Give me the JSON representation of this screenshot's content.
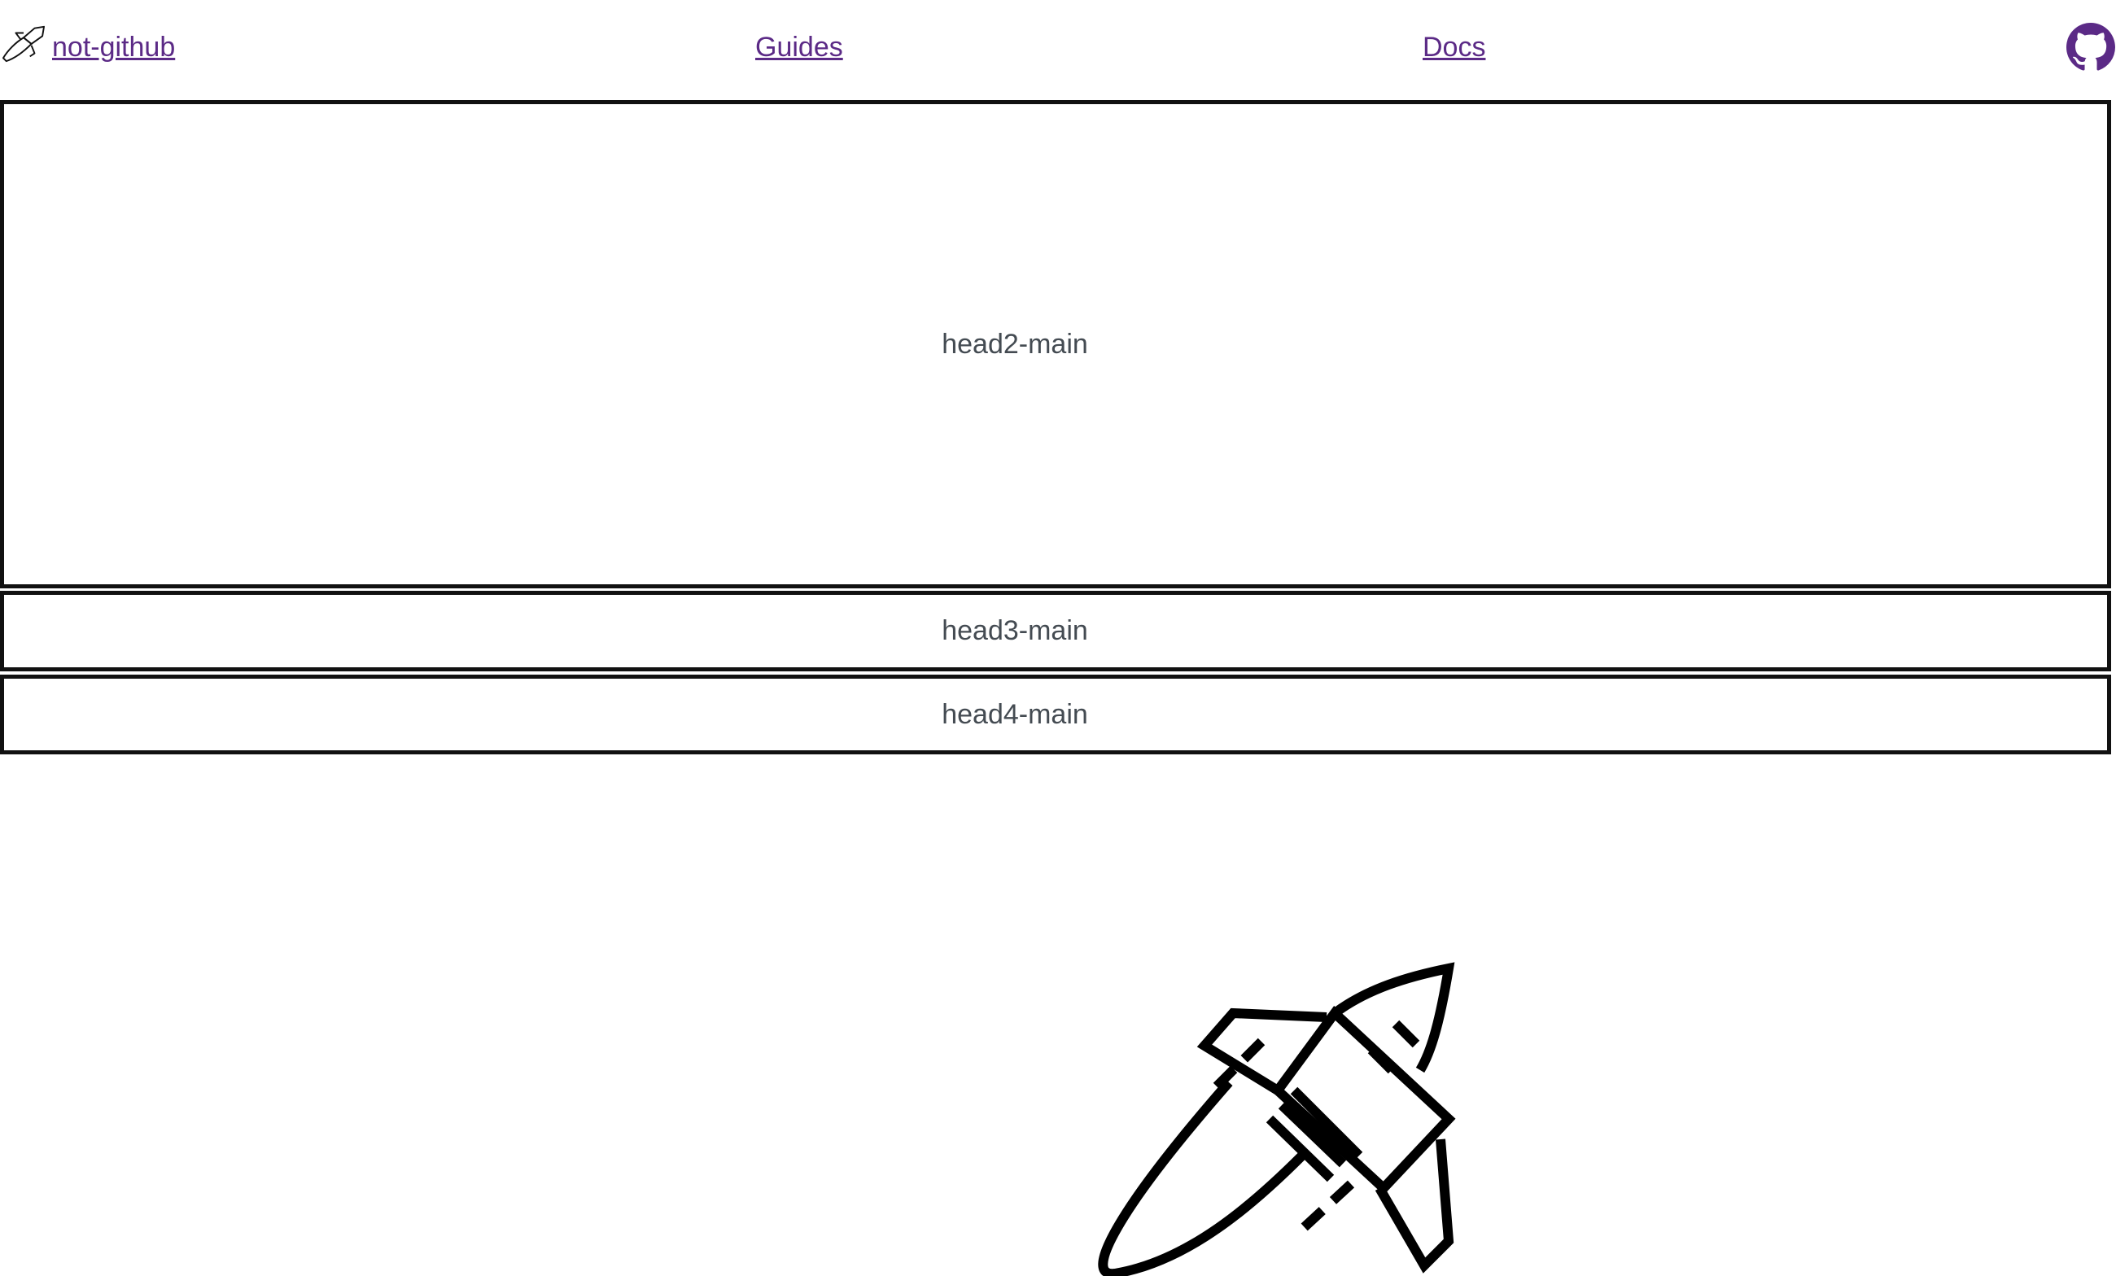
{
  "nav": {
    "brand_label": " not-github",
    "brand_icon": "rocket-icon",
    "links": [
      {
        "label": "Guides"
      },
      {
        "label": "Docs"
      }
    ],
    "github_icon": "github-icon",
    "link_color": "#5b2a86"
  },
  "sections": [
    {
      "label": "head2-main"
    },
    {
      "label": "head3-main"
    },
    {
      "label": "head4-main"
    }
  ],
  "hero": {
    "icon": "rocket-icon"
  },
  "colors": {
    "border": "#111111",
    "text": "#444b52",
    "background": "#ffffff"
  }
}
